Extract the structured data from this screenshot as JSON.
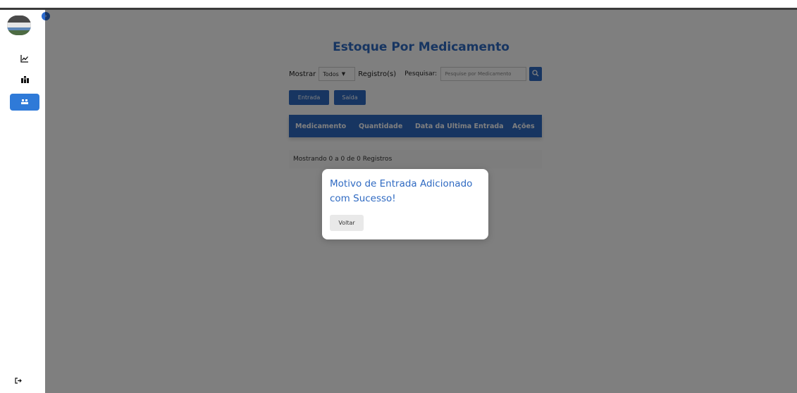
{
  "sidebar": {
    "toggle_icon": "chevron-right-icon",
    "items": [
      {
        "icon": "line-chart-icon",
        "glyph": "📈",
        "active": false
      },
      {
        "icon": "pharmacy-icon",
        "glyph": "🏥",
        "active": false
      },
      {
        "icon": "stock-icon",
        "glyph": "📦",
        "active": true
      }
    ],
    "logout_icon": "logout-icon"
  },
  "main": {
    "title": "Estoque Por Medicamento",
    "controls": {
      "show_label": "Mostrar",
      "show_value": "Todos",
      "records_label": "Registro(s)",
      "search_label": "Pesquisar:",
      "search_placeholder": "Pesquise por Medicamento"
    },
    "buttons": {
      "entrada": "Entrada",
      "saida": "Saída"
    },
    "table": {
      "headers": [
        "Medicamento",
        "Quantidade",
        "Data da Ultima Entrada",
        "Ações"
      ]
    },
    "info": "Mostrando 0 a 0 de 0 Registros"
  },
  "modal": {
    "title": "Motivo de Entrada Adicionado com Sucesso!",
    "button": "Voltar"
  },
  "colors": {
    "primary": "#2f6ac2",
    "overlay": "rgba(0,0,0,0.5)"
  }
}
